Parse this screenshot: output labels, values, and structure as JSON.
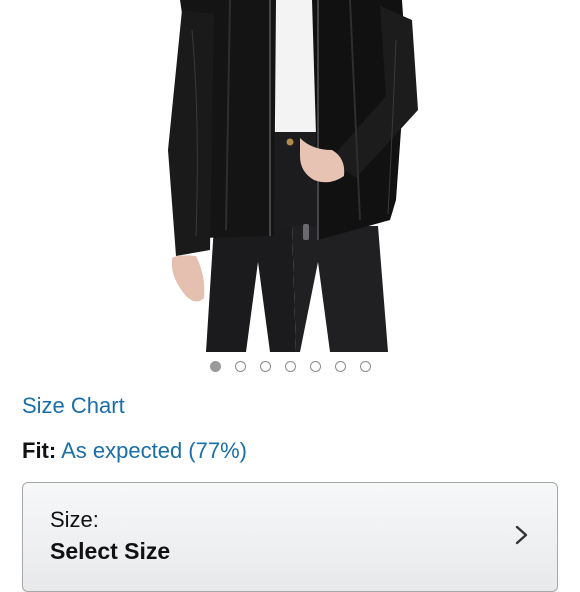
{
  "product": {
    "image_alt": "Black leather jacket worn over white top and black jeans",
    "carousel": {
      "total": 7,
      "active": 1
    }
  },
  "size_chart_label": "Size Chart",
  "fit": {
    "label": "Fit:",
    "value": "As expected (77%)"
  },
  "size_selector": {
    "label": "Size:",
    "value": "Select Size"
  },
  "colors": {
    "link": "#1a6fa8",
    "text": "#111111",
    "border": "#a8a8a8"
  }
}
